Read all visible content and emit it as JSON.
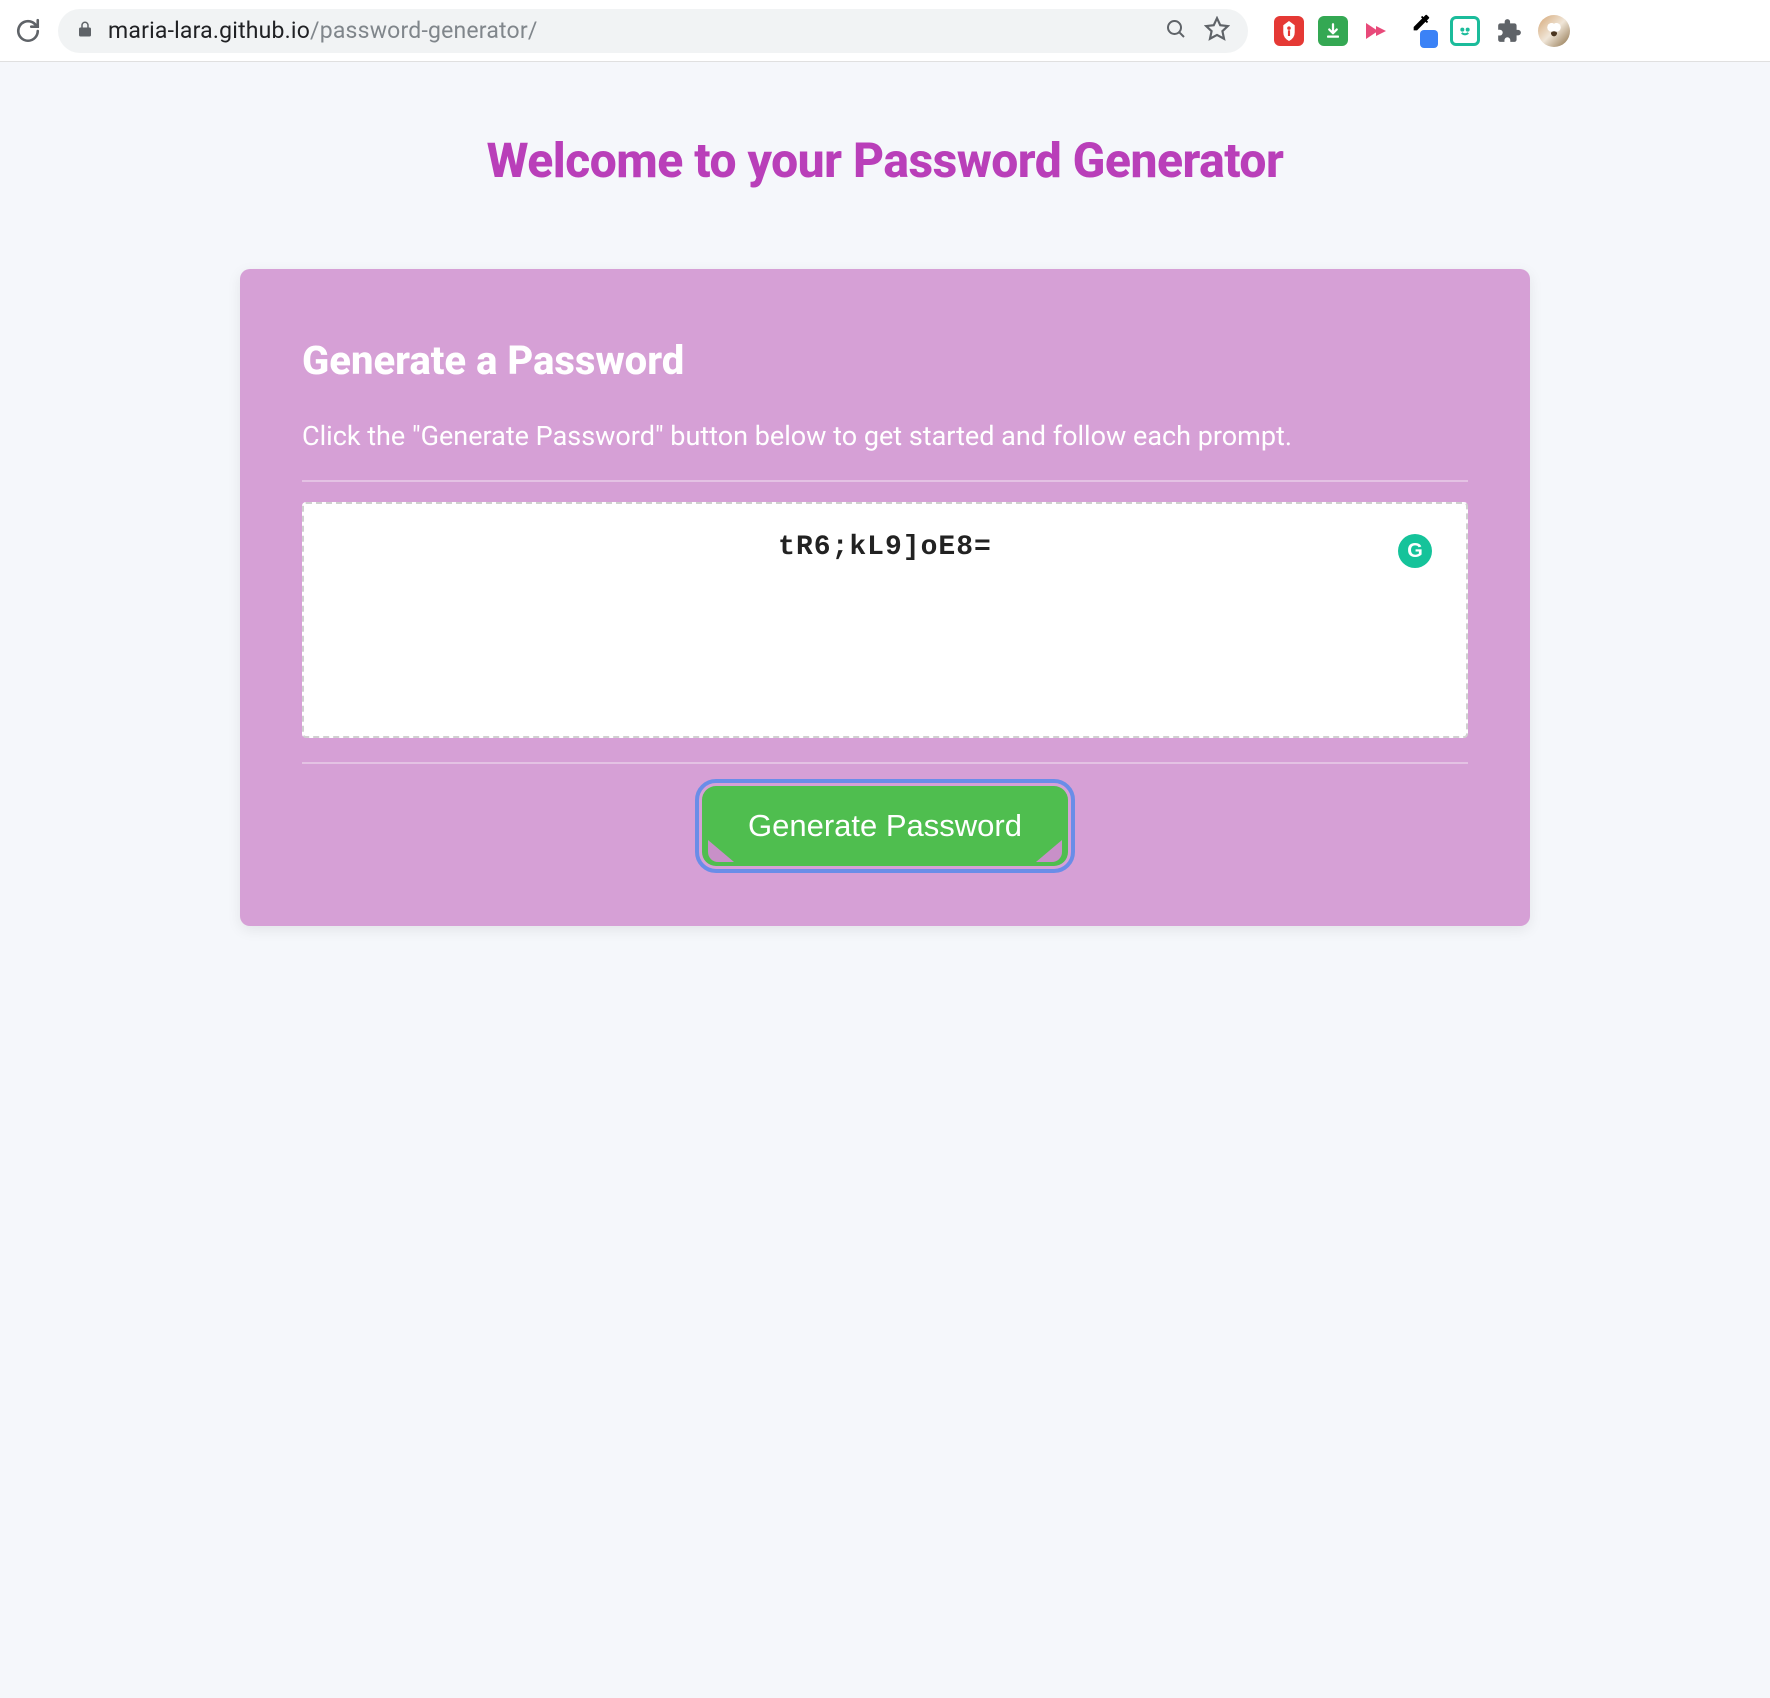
{
  "browser": {
    "url_host": "maria-lara.github.io",
    "url_path": "/password-generator/"
  },
  "page": {
    "title": "Welcome to your Password Generator"
  },
  "card": {
    "heading": "Generate a Password",
    "subtitle": "Click the \"Generate Password\" button below to get started and follow each prompt.",
    "password_value": "tR6;kL9]oE8=",
    "button_label": "Generate Password"
  },
  "grammarly": {
    "letter": "G"
  }
}
